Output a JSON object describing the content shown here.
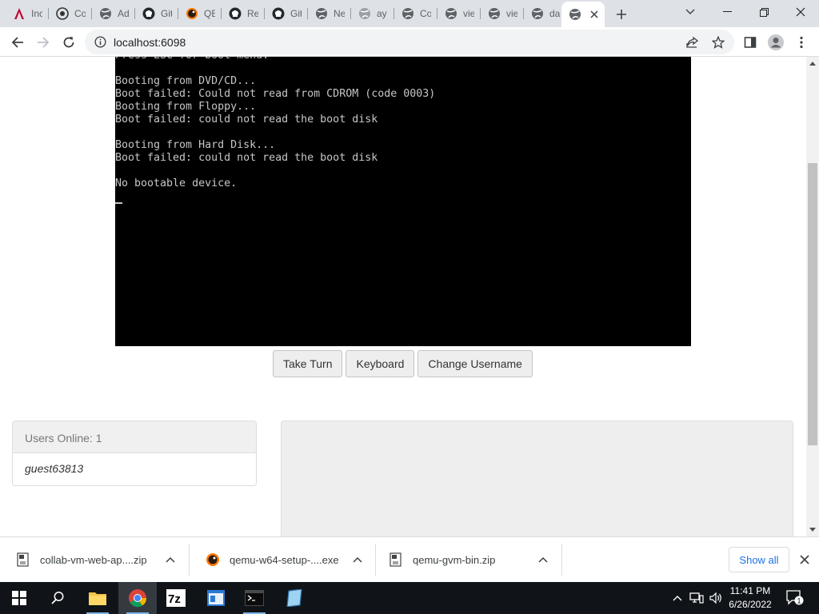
{
  "browser": {
    "tabs": [
      {
        "title": "Inc",
        "icon": "angular-icon"
      },
      {
        "title": "Co",
        "icon": "cw-icon"
      },
      {
        "title": "Ad",
        "icon": "globe-icon"
      },
      {
        "title": "Git",
        "icon": "github-icon"
      },
      {
        "title": "QE",
        "icon": "qemu-icon"
      },
      {
        "title": "Re",
        "icon": "github-icon"
      },
      {
        "title": "Git",
        "icon": "github-icon"
      },
      {
        "title": "Ne",
        "icon": "globe-icon"
      },
      {
        "title": "ay",
        "icon": "globe-gray-icon"
      },
      {
        "title": "Co",
        "icon": "globe-icon"
      },
      {
        "title": "vie",
        "icon": "globe-icon"
      },
      {
        "title": "vie",
        "icon": "globe-icon"
      },
      {
        "title": "da",
        "icon": "globe-icon"
      },
      {
        "title": "",
        "icon": "globe-icon",
        "active": true
      }
    ],
    "address": "localhost:6098"
  },
  "vm": {
    "lines": "Press ESC for boot menu.\n\nBooting from DVD/CD...\nBoot failed: Could not read from CDROM (code 0003)\nBooting from Floppy...\nBoot failed: could not read the boot disk\n\nBooting from Hard Disk...\nBoot failed: could not read the boot disk\n\nNo bootable device."
  },
  "controls": {
    "take_turn": "Take Turn",
    "keyboard": "Keyboard",
    "change_username": "Change Username"
  },
  "users": {
    "header_label": "Users Online: ",
    "count": "1",
    "list": [
      "guest63813"
    ]
  },
  "downloads": {
    "items": [
      {
        "name": "collab-vm-web-ap....zip",
        "icon": "zip-file-icon"
      },
      {
        "name": "qemu-w64-setup-....exe",
        "icon": "qemu-installer-icon"
      },
      {
        "name": "qemu-gvm-bin.zip",
        "icon": "zip-file-icon"
      }
    ],
    "show_all": "Show all"
  },
  "taskbar": {
    "time": "11:41 PM",
    "date": "6/26/2022",
    "notification_count": "1"
  }
}
